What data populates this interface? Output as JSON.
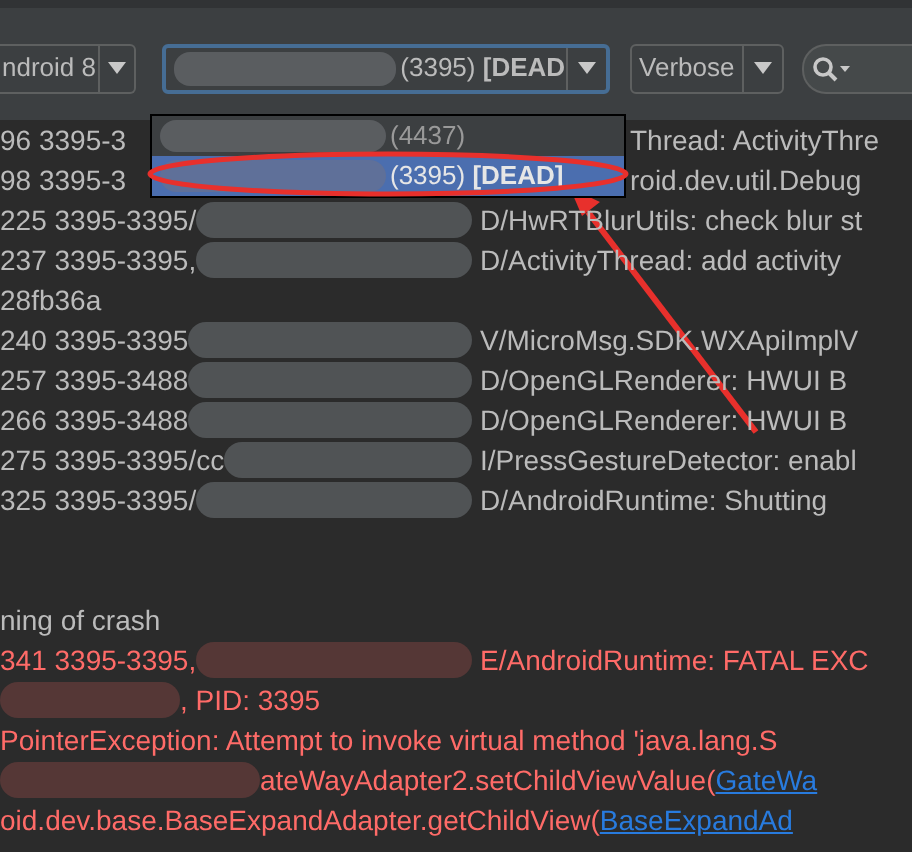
{
  "toolbar": {
    "device": "ndroid 8",
    "process": {
      "text": "(3395) **[DEAD**",
      "focused": true,
      "expanded": true
    },
    "level": "Verbose"
  },
  "process_menu": [
    {
      "text": "(4437)",
      "selected": false
    },
    {
      "text": "(3395) **[DEAD]**",
      "selected": true
    }
  ],
  "log": [
    {
      "kind": "covered",
      "error": false,
      "prefix": "96 3395-3",
      "message": "Thread: ActivityThre"
    },
    {
      "kind": "covered",
      "error": false,
      "prefix": "98 3395-3",
      "message": "roid.dev.util.Debug"
    },
    {
      "kind": "entry",
      "error": false,
      "prefix": "225 3395-3395/",
      "message": "D/HwRTBlurUtils: check blur st"
    },
    {
      "kind": "entry",
      "error": false,
      "prefix": "237 3395-3395,",
      "message": "D/ActivityThread: add activity"
    },
    {
      "kind": "plain",
      "error": false,
      "message": "28fb36a"
    },
    {
      "kind": "entry",
      "error": false,
      "prefix": "240 3395-3395",
      "message": "V/MicroMsg.SDK.WXApiImplV"
    },
    {
      "kind": "entry",
      "error": false,
      "prefix": "257 3395-3488",
      "message": "D/OpenGLRenderer:   HWUI B"
    },
    {
      "kind": "entry",
      "error": false,
      "prefix": "266 3395-3488",
      "message": "D/OpenGLRenderer:   HWUI B"
    },
    {
      "kind": "entry",
      "error": false,
      "prefix": "275 3395-3395/cc",
      "message": "I/PressGestureDetector: enabl"
    },
    {
      "kind": "entry",
      "error": false,
      "prefix": "325 3395-3395/",
      "message": "D/AndroidRuntime: Shutting"
    },
    {
      "kind": "after_gap",
      "error": false,
      "message": "ning of crash"
    },
    {
      "kind": "entry",
      "error": true,
      "prefix": "341 3395-3395,",
      "message": "E/AndroidRuntime: FATAL EXC"
    },
    {
      "kind": "masked_head",
      "error": true,
      "message": ", PID: 3395"
    },
    {
      "kind": "plain",
      "error": true,
      "message": "PointerException: Attempt to invoke virtual method 'java.lang.S"
    },
    {
      "kind": "masked_head",
      "error": true,
      "message": "ateWayAdapter2.setChildViewValue(",
      "link": "GateWa"
    },
    {
      "kind": "plain",
      "error": true,
      "message": "oid.dev.base.BaseExpandAdapter.getChildView(",
      "link": "BaseExpandAd"
    }
  ]
}
